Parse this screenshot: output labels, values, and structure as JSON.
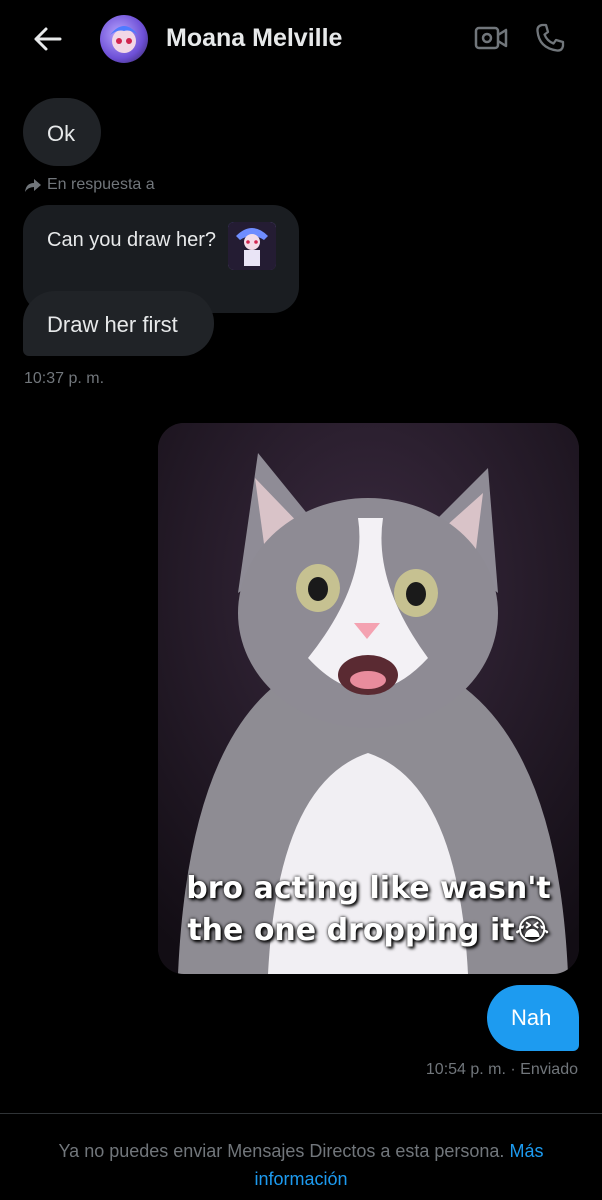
{
  "header": {
    "title": "Moana Melville",
    "icons": [
      "back-arrow-icon",
      "video-call-icon",
      "phone-icon"
    ]
  },
  "messages": {
    "ok": "Ok",
    "reply_hint": "En respuesta a",
    "quoted_text": "Can you draw her?",
    "draw_first": "Draw her first",
    "time_received": "10:37 p. m.",
    "image_caption_line1": "bro acting like wasn't",
    "image_caption_line2": "the one dropping it😭",
    "nah": "Nah",
    "time_sent": "10:54 p. m. · Enviado"
  },
  "footer": {
    "notice": "Ya no puedes enviar Mensajes Directos a esta persona.",
    "link": "Más información"
  },
  "colors": {
    "background": "#000000",
    "bubble_received": "#202327",
    "bubble_sent": "#1d9bf0",
    "muted_text": "#71767b",
    "link": "#1d9bf0"
  }
}
